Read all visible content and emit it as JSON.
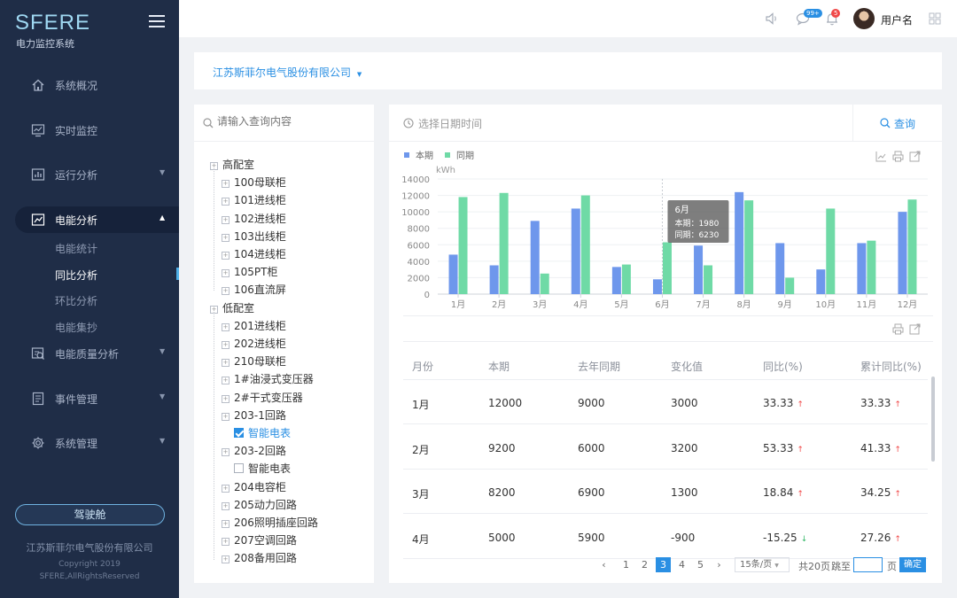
{
  "app": {
    "logo": "SFERE",
    "subtitle": "电力监控系统"
  },
  "sidebar": {
    "items": [
      {
        "label": "系统概况",
        "icon": "home-icon"
      },
      {
        "label": "实时监控",
        "icon": "monitor-icon"
      },
      {
        "label": "运行分析",
        "icon": "bar-chart-icon"
      },
      {
        "label": "电能分析",
        "icon": "line-chart-icon"
      },
      {
        "label": "电能质量分析",
        "icon": "quality-icon"
      },
      {
        "label": "事件管理",
        "icon": "document-icon"
      },
      {
        "label": "系统管理",
        "icon": "gear-icon"
      }
    ],
    "subitems": [
      "电能统计",
      "同比分析",
      "环比分析",
      "电能集抄"
    ],
    "cockpit_label": "驾驶舱",
    "footer_company": "江苏斯菲尔电气股份有限公司",
    "footer_copyright": "Copyright 2019",
    "footer_rights": "SFERE,AllRightsReserved"
  },
  "topbar": {
    "username": "用户名",
    "messages_badge": "99+",
    "alerts_badge": "5"
  },
  "company": {
    "selected": "江苏斯菲尔电气股份有限公司"
  },
  "tree": {
    "search_placeholder": "请输入查询内容",
    "nodes": [
      "高配室",
      "100母联柜",
      "101进线柜",
      "102进线柜",
      "103出线柜",
      "104进线柜",
      "105PT柜",
      "106直流屏",
      "低配室",
      "201进线柜",
      "202进线柜",
      "210母联柜",
      "1#油浸式变压器",
      "2#干式变压器",
      "203-1回路",
      "智能电表",
      "203-2回路",
      "智能电表",
      "204电容柜",
      "205动力回路",
      "206照明插座回路",
      "207空调回路",
      "208备用回路"
    ]
  },
  "query": {
    "date_placeholder": "选择日期时间",
    "button_label": "查询"
  },
  "chart_data": {
    "type": "bar",
    "unit": "kWh",
    "categories": [
      "1月",
      "2月",
      "3月",
      "4月",
      "5月",
      "6月",
      "7月",
      "8月",
      "9月",
      "10月",
      "11月",
      "12月"
    ],
    "series": [
      {
        "name": "本期",
        "color": "#6e97ec",
        "values": [
          4800,
          3500,
          8900,
          10400,
          3300,
          1800,
          5900,
          12400,
          6200,
          3000,
          6200,
          10000
        ]
      },
      {
        "name": "同期",
        "color": "#6fdaa6",
        "values": [
          11800,
          12300,
          2500,
          12000,
          3600,
          6300,
          3500,
          11400,
          2000,
          10400,
          6500,
          11500
        ]
      }
    ],
    "ylim": [
      0,
      14000
    ],
    "yticks": [
      0,
      2000,
      4000,
      6000,
      8000,
      10000,
      12000,
      14000
    ],
    "tooltip": {
      "title": "6月",
      "line1": "本期：1980",
      "line2": "同期：6230"
    }
  },
  "table": {
    "headers": [
      "月份",
      "本期",
      "去年同期",
      "变化值",
      "同比(%)",
      "累计同比(%)"
    ],
    "rows": [
      {
        "month": "1月",
        "current": "12000",
        "last": "9000",
        "change": "3000",
        "yoy": "33.33",
        "yoy_dir": "up",
        "cum": "33.33",
        "cum_dir": "up"
      },
      {
        "month": "2月",
        "current": "9200",
        "last": "6000",
        "change": "3200",
        "yoy": "53.33",
        "yoy_dir": "up",
        "cum": "41.33",
        "cum_dir": "up"
      },
      {
        "month": "3月",
        "current": "8200",
        "last": "6900",
        "change": "1300",
        "yoy": "18.84",
        "yoy_dir": "up",
        "cum": "34.25",
        "cum_dir": "up"
      },
      {
        "month": "4月",
        "current": "5000",
        "last": "5900",
        "change": "-900",
        "yoy": "-15.25",
        "yoy_dir": "down",
        "cum": "27.26",
        "cum_dir": "up"
      }
    ]
  },
  "pagination": {
    "pages": [
      "1",
      "2",
      "3",
      "4",
      "5"
    ],
    "current": "3",
    "page_size": "15条/页",
    "total": "共20页",
    "jump_label": "跳至",
    "page_unit": "页",
    "ok_label": "确定"
  }
}
